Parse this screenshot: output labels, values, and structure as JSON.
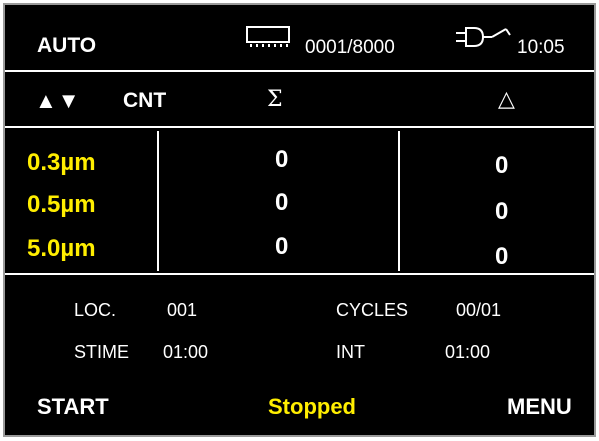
{
  "status_bar": {
    "mode": "AUTO",
    "memory_counter": "0001/8000",
    "time": "10:05",
    "memory_icon": "memory-chip-icon",
    "power_icon": "power-plug-icon"
  },
  "table_header": {
    "sort_arrows": "▲▼",
    "count_label": "CNT",
    "sum_symbol": "Σ",
    "delta_symbol": "△"
  },
  "rows": [
    {
      "size": "0.3µm",
      "sum": "0",
      "delta": "0"
    },
    {
      "size": "0.5µm",
      "sum": "0",
      "delta": "0"
    },
    {
      "size": "5.0µm",
      "sum": "0",
      "delta": "0"
    }
  ],
  "settings": {
    "loc_label": "LOC.",
    "loc_value": "001",
    "cycles_label": "CYCLES",
    "cycles_value": "00/01",
    "stime_label": "STIME",
    "stime_value": "01:00",
    "int_label": "INT",
    "int_value": "01:00"
  },
  "footer": {
    "start_label": "START",
    "status_text": "Stopped",
    "menu_label": "MENU"
  },
  "colors": {
    "background": "#000000",
    "text": "#ffffff",
    "highlight": "#ffee00"
  }
}
